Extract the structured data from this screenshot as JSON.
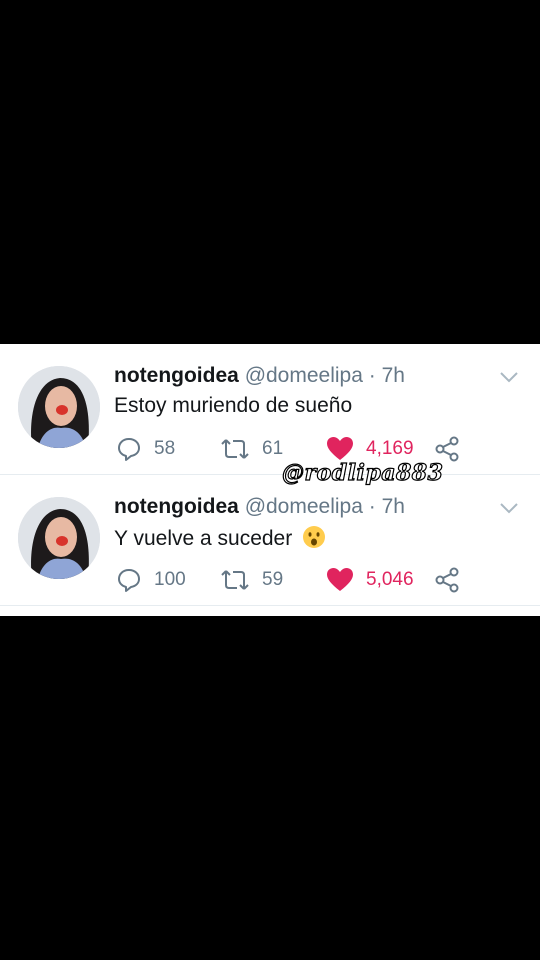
{
  "tweets": [
    {
      "display_name": "notengoidea",
      "handle": "@domeelipa",
      "separator": "·",
      "time": "7h",
      "text": "Estoy muriendo de sueño",
      "replies": "58",
      "retweets": "61",
      "likes": "4,169"
    },
    {
      "display_name": "notengoidea",
      "handle": "@domeelipa",
      "separator": "·",
      "time": "7h",
      "text": "Y vuelve a suceder",
      "replies": "100",
      "retweets": "59",
      "likes": "5,046"
    }
  ],
  "watermark": "@rodlipa883",
  "colors": {
    "like": "#e0245e",
    "muted": "#657786",
    "text": "#14171a",
    "background": "#000000"
  },
  "icons": [
    "reply-icon",
    "retweet-icon",
    "heart-icon",
    "share-icon",
    "chevron-down-icon",
    "astonished-face-emoji"
  ]
}
